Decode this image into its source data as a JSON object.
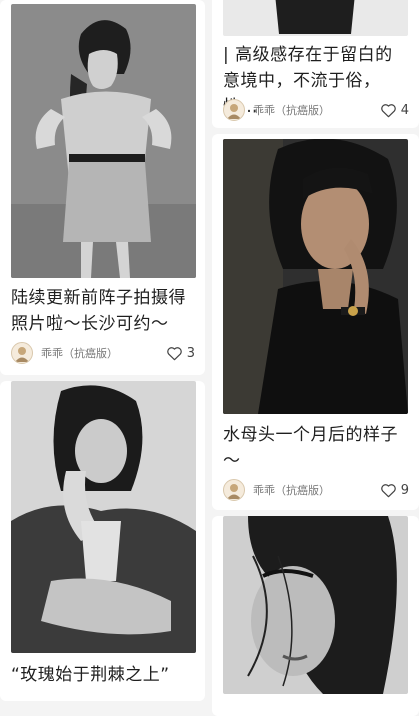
{
  "feed": {
    "posts": [
      {
        "title": "陆续更新前阵子拍摄得照片啦～长沙可约～",
        "author": "乖乖（抗癌版）",
        "likes": "3",
        "photo": "portrait-dress-photo"
      },
      {
        "title": "“玫瑰始于荆棘之上”",
        "photo": "portrait-hands-photo"
      },
      {
        "title": "| 高级感存在于留白的意境中，不流于俗，性…",
        "author": "乖乖（抗癌版）",
        "likes": "4"
      },
      {
        "title": "水母头一个月后的样子～",
        "author": "乖乖（抗癌版）",
        "likes": "9",
        "photo": "portrait-bob-photo"
      },
      {
        "photo": "portrait-hair-photo"
      }
    ]
  },
  "icons": {
    "like": "heart-outline-icon",
    "avatar": "user-avatar"
  },
  "colors": {
    "background": "#f4f4f4",
    "card": "#ffffff",
    "text": "#1f1f1f",
    "meta": "#777777"
  }
}
